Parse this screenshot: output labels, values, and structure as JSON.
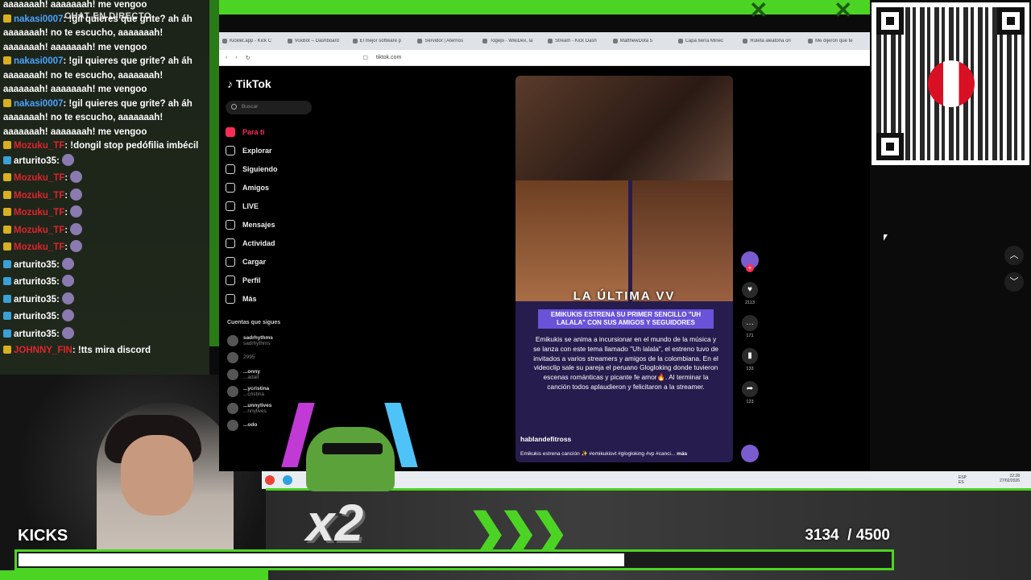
{
  "chat": {
    "title": "CHAT EN DIRECTO",
    "messages": [
      {
        "user": "",
        "text": "aaaaaaah! aaaaaaah! me vengoo",
        "user_color": "none"
      },
      {
        "user": "nakasi0007",
        "text": ": !gil quieres que grite? ah áh aaaaaaah! no te escucho, aaaaaaah! aaaaaaah! aaaaaaah! me vengoo",
        "user_color": "blue"
      },
      {
        "user": "nakasi0007",
        "text": ": !gil quieres que grite? ah áh aaaaaaah! no te escucho, aaaaaaah! aaaaaaah! aaaaaaah! me vengoo",
        "user_color": "blue"
      },
      {
        "user": "nakasi0007",
        "text": ": !gil quieres que grite? ah áh aaaaaaah! no te escucho, aaaaaaah! aaaaaaah! aaaaaaah! me vengoo",
        "user_color": "blue"
      },
      {
        "user": "Mozuku_TF",
        "text": ": !dongil stop pedófilia imbécil",
        "user_color": "red"
      },
      {
        "user": "arturito35",
        "text": ":",
        "user_color": "white"
      },
      {
        "user": "Mozuku_TF",
        "text": ":",
        "user_color": "red"
      },
      {
        "user": "Mozuku_TF",
        "text": ":",
        "user_color": "red"
      },
      {
        "user": "Mozuku_TF",
        "text": ":",
        "user_color": "red"
      },
      {
        "user": "Mozuku_TF",
        "text": ":",
        "user_color": "red"
      },
      {
        "user": "Mozuku_TF",
        "text": ":",
        "user_color": "red"
      },
      {
        "user": "arturito35",
        "text": ":",
        "user_color": "white"
      },
      {
        "user": "arturito35",
        "text": ":",
        "user_color": "white"
      },
      {
        "user": "arturito35",
        "text": ":",
        "user_color": "white"
      },
      {
        "user": "arturito35",
        "text": ":",
        "user_color": "white"
      },
      {
        "user": "arturito35",
        "text": ":",
        "user_color": "white"
      },
      {
        "user": "JOHNNY_FIN",
        "text": ": !tts mira discord",
        "user_color": "red"
      }
    ]
  },
  "browser": {
    "tabs": [
      "Kicklet.app - Kick C",
      "VoxBot – Dashboard",
      "El mejor software p",
      "Servidor | Aternos",
      "Togepi - WikiDex, la",
      "Stream - Kick Dash",
      "MatthewDota 5",
      "Capa tierra Minec",
      "Ruleta aleatoria on",
      "Me dijeron que te"
    ],
    "url": "tiktok.com"
  },
  "tiktok": {
    "logo": "TikTok",
    "search_placeholder": "Buscar",
    "nav": [
      {
        "label": "Para ti",
        "icon": "home-icon",
        "active": true
      },
      {
        "label": "Explorar",
        "icon": "compass-icon",
        "active": false
      },
      {
        "label": "Siguiendo",
        "icon": "following-icon",
        "active": false
      },
      {
        "label": "Amigos",
        "icon": "friends-icon",
        "active": false
      },
      {
        "label": "LIVE",
        "icon": "live-icon",
        "active": false
      },
      {
        "label": "Mensajes",
        "icon": "message-icon",
        "active": false
      },
      {
        "label": "Actividad",
        "icon": "activity-icon",
        "active": false
      },
      {
        "label": "Cargar",
        "icon": "upload-icon",
        "active": false
      },
      {
        "label": "Perfil",
        "icon": "profile-icon",
        "active": false
      },
      {
        "label": "Más",
        "icon": "more-icon",
        "active": false
      }
    ],
    "following_title": "Cuentas que sigues",
    "following": [
      {
        "name": "sadrhythms",
        "handle": "sadrhythms"
      },
      {
        "name": "",
        "handle": "2995"
      },
      {
        "name": "...onny",
        "handle": "...adall"
      },
      {
        "name": "...ycristina",
        "handle": "...cristina"
      },
      {
        "name": "...unnylives",
        "handle": "...nnylives"
      },
      {
        "name": "...odo",
        "handle": ""
      }
    ],
    "video": {
      "overlay_title": "LA ÚLTIMA VV",
      "headline": "EMIKUKIS ESTRENA SU PRIMER SENCILLO \"UH LALALA\" CON SUS AMIGOS Y SEGUIDORES",
      "body": "Emikukis se anima a incursionar en el mundo de la música y se lanza con este tema llamado \"Uh lalala\", el estreno tuvo de invitados a varios streamers y amigos de la colombiana. En el videoclip sale su pareja el peruano Glogloking donde tuvieron escenas románticas y picante fe amor🔥. Al terminar la canción todos aplaudieron y felicitaron a la streamer.",
      "username": "hablandefitross",
      "caption": "Emikukis estrena canción ✨ #emikukisvt #glogloking #vp #canci...",
      "more": "más"
    },
    "actions": [
      {
        "icon": "heart-icon",
        "count": "2113"
      },
      {
        "icon": "comment-icon",
        "count": "171"
      },
      {
        "icon": "bookmark-icon",
        "count": "133"
      },
      {
        "icon": "share-icon",
        "count": "123"
      }
    ]
  },
  "taskbar": {
    "lang_top": "ESP",
    "lang_bottom": "ES",
    "time": "22:28",
    "date": "27/02/2026"
  },
  "overlay": {
    "multiplier": "x2",
    "goal_label": "KICKS",
    "current": "3134",
    "target": "/ 4500",
    "progress": 0.6964,
    "accent": "#4cd424"
  }
}
